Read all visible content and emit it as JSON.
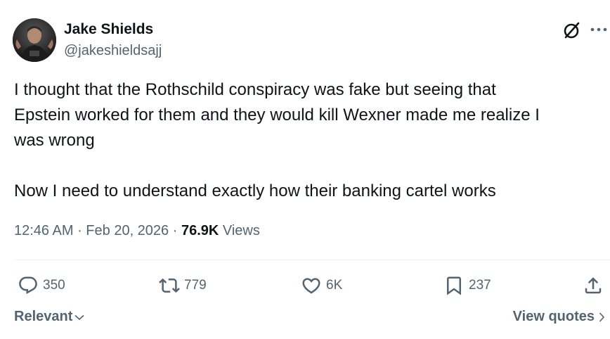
{
  "author": {
    "display_name": "Jake Shields",
    "handle": "@jakeshieldsajj"
  },
  "header_icons": {
    "grok": "grok-icon",
    "more": "more-options-icon"
  },
  "tweet": {
    "paragraphs": [
      "I thought that the Rothschild conspiracy was fake but seeing that\nEpstein worked for them and they would kill Wexner made me realize I\nwas wrong",
      "Now I need to understand exactly how their banking cartel works"
    ]
  },
  "meta": {
    "time": "12:46 AM",
    "separator": " · ",
    "date": "Feb 20, 2026",
    "views_count": "76.9K",
    "views_label": " Views"
  },
  "actions": {
    "replies": "350",
    "reposts": "779",
    "likes": "6K",
    "bookmarks": "237"
  },
  "footer": {
    "sort_label": "Relevant",
    "quotes_label": "View quotes"
  },
  "colors": {
    "text_primary": "#0f1419",
    "text_secondary": "#536471",
    "divider": "#eff3f4"
  }
}
